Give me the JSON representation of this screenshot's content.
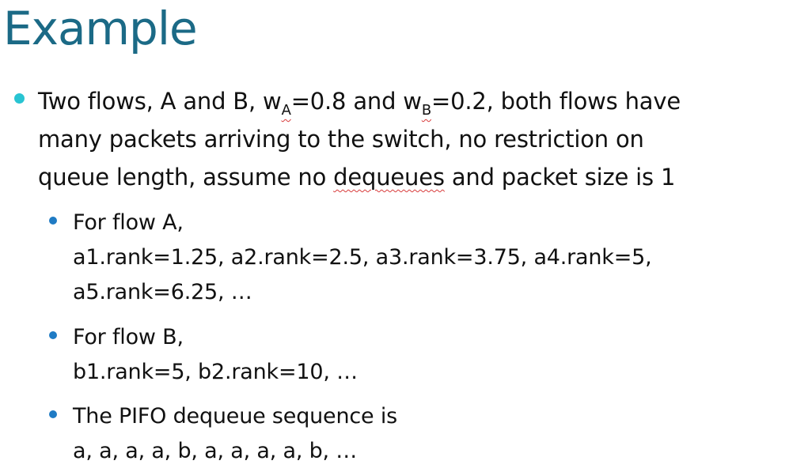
{
  "title": "Example",
  "main_bullet": {
    "part1": "Two flows, A and B, w",
    "sub_a": "A",
    "part2": "=0.8 and w",
    "sub_b": "B",
    "part3": "=0.2, both flows have",
    "line2": "many packets arriving to the switch, no restriction on",
    "line3_pre": "queue length, assume no ",
    "line3_word": "dequeues",
    "line3_post": " and packet size is 1"
  },
  "sub_bullets": [
    {
      "lines": [
        "For flow A,",
        "a1.rank=1.25, a2.rank=2.5, a3.rank=3.75, a4.rank=5,",
        "a5.rank=6.25, …"
      ]
    },
    {
      "lines": [
        "For flow B,",
        "b1.rank=5, b2.rank=10, …"
      ]
    },
    {
      "lines": [
        "The PIFO dequeue sequence is",
        "a, a, a, a, b, a, a, a, a, b, …"
      ]
    }
  ],
  "colors": {
    "title": "#1b6a86",
    "main_bullet": "#28c4d2",
    "sub_bullet": "#1f7bc4",
    "spellcheck": "#d83b3b"
  }
}
